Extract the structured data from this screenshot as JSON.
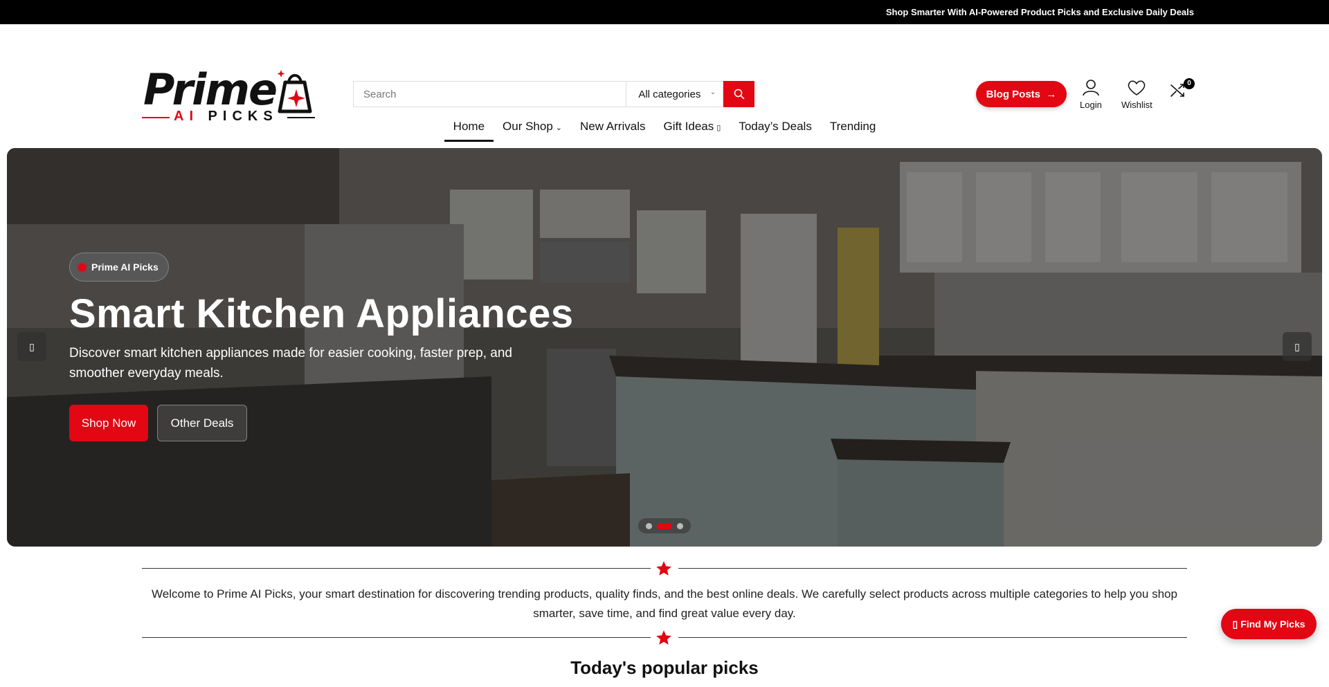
{
  "topbar": {
    "text": "Shop Smarter With AI-Powered Product Picks and Exclusive Daily Deals"
  },
  "logo": {
    "word": "Prime",
    "sub_ai": "AI",
    "sub_rest": " PICKS"
  },
  "search": {
    "placeholder": "Search",
    "category": "All categories",
    "icon": "search-icon"
  },
  "header_actions": {
    "blog_label": "Blog Posts",
    "blog_arrow": "→",
    "login_label": "Login",
    "wishlist_label": "Wishlist",
    "cart_count": "0"
  },
  "nav": {
    "items": [
      {
        "label": "Home",
        "active": true
      },
      {
        "label": "Our Shop",
        "dropdown": true
      },
      {
        "label": "New Arrivals"
      },
      {
        "label": "Gift Ideas",
        "dropdown": true
      },
      {
        "label": "Today’s Deals"
      },
      {
        "label": "Trending"
      }
    ]
  },
  "hero": {
    "badge": "Prime AI Picks",
    "title": "Smart Kitchen Appliances",
    "description": "Discover smart kitchen appliances made for easier cooking, faster prep, and smoother everyday meals.",
    "primary_button": "Shop Now",
    "secondary_button": "Other Deals",
    "prev_icon": "chevron-left-icon",
    "next_icon": "chevron-right-icon",
    "slide_count": 3,
    "active_slide": 2
  },
  "welcome": {
    "text": "Welcome to Prime AI Picks, your smart destination for discovering trending products, quality finds, and the best online deals. We carefully select products across multiple categories to help you shop smarter, save time, and find great value every day."
  },
  "section": {
    "title": "Today's popular picks"
  },
  "floating": {
    "label": "Find My Picks"
  },
  "colors": {
    "accent": "#e30613",
    "topbar": "#000000"
  }
}
